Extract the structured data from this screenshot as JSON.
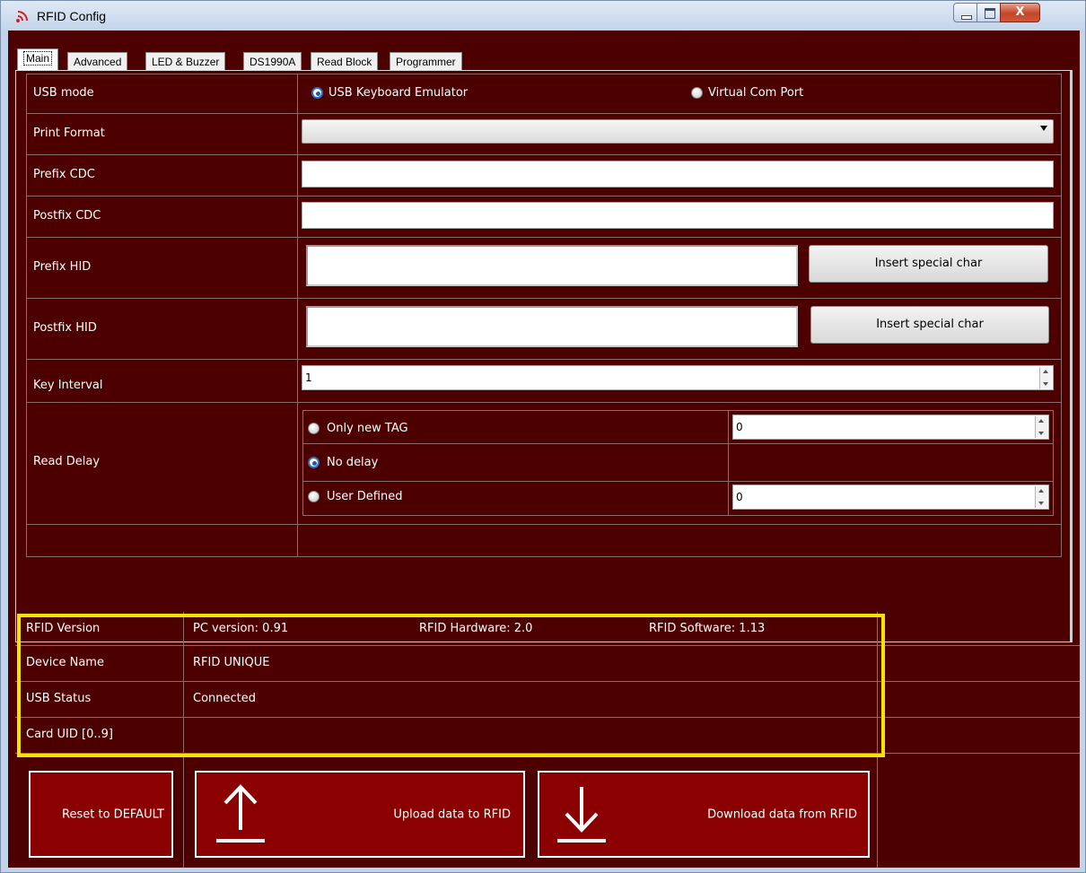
{
  "window": {
    "title": "RFID Config",
    "minimize_icon": "minimize-icon",
    "maximize_icon": "maximize-icon",
    "close_label": "X"
  },
  "tabs": [
    {
      "label": "Main",
      "active": true
    },
    {
      "label": "Advanced"
    },
    {
      "label": "LED & Buzzer"
    },
    {
      "label": "DS1990A"
    },
    {
      "label": "Read Block"
    },
    {
      "label": "Programmer"
    }
  ],
  "main": {
    "usb_mode": {
      "label": "USB mode",
      "options": [
        "USB Keyboard Emulator",
        "Virtual Com Port"
      ],
      "selected": "USB Keyboard Emulator"
    },
    "print_format": {
      "label": "Print Format",
      "value": ""
    },
    "prefix_cdc": {
      "label": "Prefix CDC",
      "value": ""
    },
    "postfix_cdc": {
      "label": "Postfix CDC",
      "value": ""
    },
    "prefix_hid": {
      "label": "Prefix HID",
      "value": "",
      "button": "Insert special char"
    },
    "postfix_hid": {
      "label": "Postfix HID",
      "value": "",
      "button": "Insert special char"
    },
    "key_interval": {
      "label": "Key Interval",
      "value": "1"
    },
    "read_delay": {
      "label": "Read Delay",
      "options": [
        {
          "label": "Only new TAG",
          "value": "0"
        },
        {
          "label": "No delay"
        },
        {
          "label": "User Defined",
          "value": "0"
        }
      ],
      "selected": "No delay"
    }
  },
  "info": {
    "rfid_version_label": "RFID Version",
    "pc_version": "PC version: 0.91",
    "rfid_hardware": "RFID Hardware: 2.0",
    "rfid_software": "RFID Software: 1.13",
    "device_name_label": "Device Name",
    "device_name": "RFID UNIQUE",
    "usb_status_label": "USB Status",
    "usb_status": "Connected",
    "card_uid_label": "Card UID [0..9]",
    "card_uid": ""
  },
  "actions": {
    "reset": "Reset to DEFAULT",
    "upload": "Upload data to RFID",
    "download": "Download data from RFID"
  },
  "colors": {
    "background": "#4d0000",
    "button_fill": "#8b0000",
    "highlight": "#f5e400"
  }
}
